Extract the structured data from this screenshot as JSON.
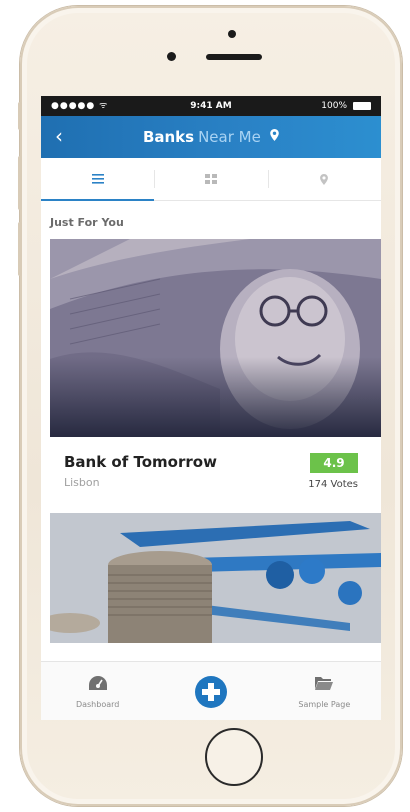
{
  "statusbar": {
    "signal": "●●●●● ᯤ",
    "time": "9:41 AM",
    "battery": "100%"
  },
  "navbar": {
    "back": "‹",
    "title_main": "Banks",
    "title_sub": "Near Me"
  },
  "tabs": [
    {
      "name": "list-view",
      "glyph": "≡"
    },
    {
      "name": "grid-view",
      "glyph": "▦"
    },
    {
      "name": "map-view",
      "glyph": "⦿"
    }
  ],
  "section": {
    "title": "Just For You"
  },
  "cards": [
    {
      "name": "Bank of Tomorrow",
      "city": "Lisbon",
      "rating": "4.9",
      "votes": "174 Votes"
    }
  ],
  "bottom_nav": [
    {
      "label": "Dashboard",
      "icon": "dashboard-icon"
    },
    {
      "label": "",
      "icon": "plus-icon"
    },
    {
      "label": "Sample Page",
      "icon": "folder-icon"
    }
  ],
  "colors": {
    "navbar": "#2a82c6",
    "accent": "#2b82c6",
    "rating": "#6cc24a",
    "plus": "#1f76bf"
  }
}
